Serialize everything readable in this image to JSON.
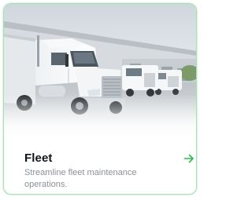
{
  "card": {
    "title": "Fleet",
    "description": "Streamline fleet maintenance operations.",
    "image_icon": "truck-fleet-photo",
    "action_icon": "arrow-right-icon",
    "accent_color": "#2fb84a",
    "border_color": "#a6e3b2"
  }
}
